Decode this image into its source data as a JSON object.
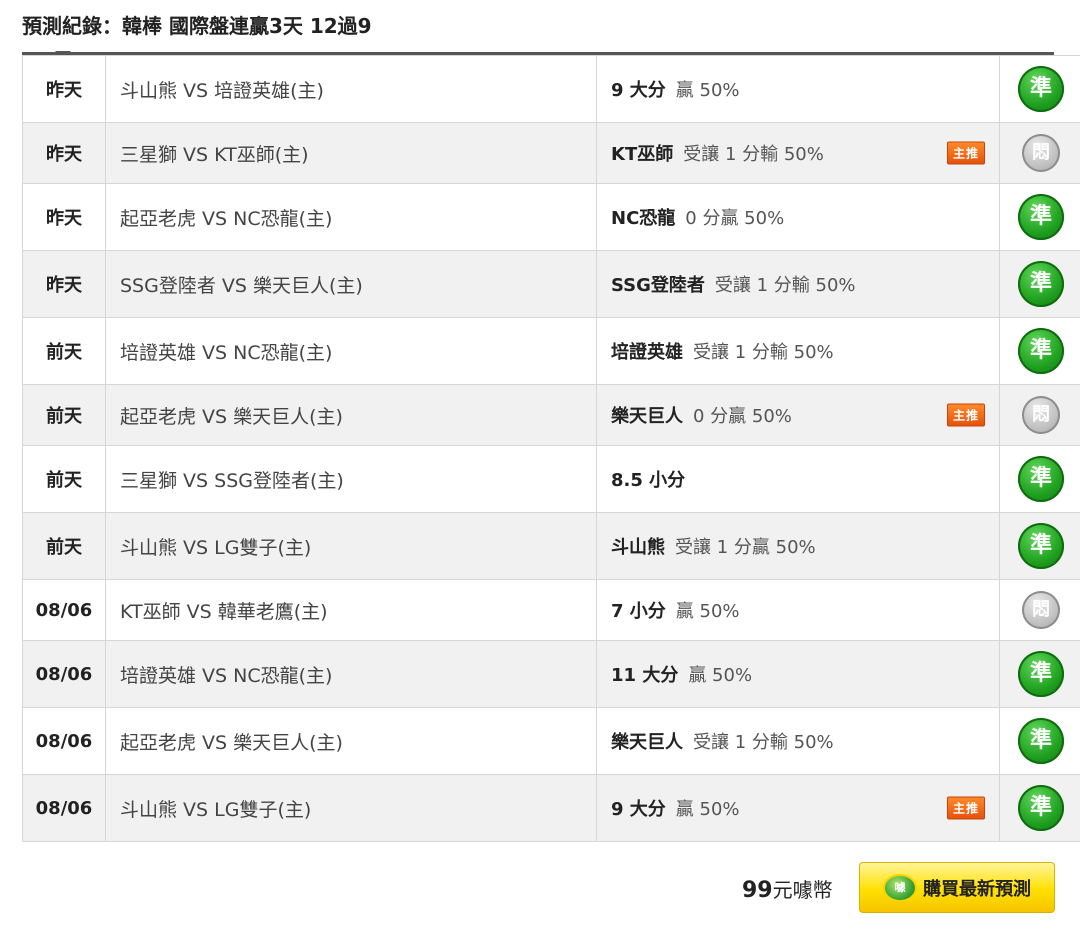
{
  "header": {
    "title": "預測紀錄：韓棒 國際盤連贏3天 12過9"
  },
  "badge_label": "主推",
  "result_labels": {
    "win": "準",
    "void": "悶"
  },
  "rows": [
    {
      "day": "昨天",
      "match": "斗山熊 VS 培證英雄(主)",
      "pick_team": "9 大分",
      "pick_detail": "贏 50%",
      "featured": false,
      "result": "win"
    },
    {
      "day": "昨天",
      "match": "三星獅 VS KT巫師(主)",
      "pick_team": "KT巫師",
      "pick_detail": "受讓 1 分輸 50%",
      "featured": true,
      "result": "void"
    },
    {
      "day": "昨天",
      "match": "起亞老虎 VS NC恐龍(主)",
      "pick_team": "NC恐龍",
      "pick_detail": "0 分贏 50%",
      "featured": false,
      "result": "win"
    },
    {
      "day": "昨天",
      "match": "SSG登陸者 VS 樂天巨人(主)",
      "pick_team": "SSG登陸者",
      "pick_detail": "受讓 1 分輸 50%",
      "featured": false,
      "result": "win"
    },
    {
      "day": "前天",
      "match": "培證英雄 VS NC恐龍(主)",
      "pick_team": "培證英雄",
      "pick_detail": "受讓 1 分輸 50%",
      "featured": false,
      "result": "win"
    },
    {
      "day": "前天",
      "match": "起亞老虎 VS 樂天巨人(主)",
      "pick_team": "樂天巨人",
      "pick_detail": "0 分贏 50%",
      "featured": true,
      "result": "void"
    },
    {
      "day": "前天",
      "match": "三星獅 VS SSG登陸者(主)",
      "pick_team": "8.5 小分",
      "pick_detail": "",
      "featured": false,
      "result": "win"
    },
    {
      "day": "前天",
      "match": "斗山熊 VS LG雙子(主)",
      "pick_team": "斗山熊",
      "pick_detail": "受讓 1 分贏 50%",
      "featured": false,
      "result": "win"
    },
    {
      "day": "08/06",
      "match": "KT巫師 VS 韓華老鷹(主)",
      "pick_team": "7 小分",
      "pick_detail": "贏 50%",
      "featured": false,
      "result": "void"
    },
    {
      "day": "08/06",
      "match": "培證英雄 VS NC恐龍(主)",
      "pick_team": "11 大分",
      "pick_detail": "贏 50%",
      "featured": false,
      "result": "win"
    },
    {
      "day": "08/06",
      "match": "起亞老虎 VS 樂天巨人(主)",
      "pick_team": "樂天巨人",
      "pick_detail": "受讓 1 分輸 50%",
      "featured": false,
      "result": "win"
    },
    {
      "day": "08/06",
      "match": "斗山熊 VS LG雙子(主)",
      "pick_team": "9 大分",
      "pick_detail": "贏 50%",
      "featured": true,
      "result": "win"
    }
  ],
  "footer": {
    "price_amount": "99",
    "price_unit": "元噱幣",
    "coin_icon_label": "噱",
    "buy_label": "購買最新預測"
  },
  "colors": {
    "win": "#1f9e1f",
    "void": "#bdbdbd",
    "badge": "#e6520a",
    "buy": "#ffe000"
  }
}
